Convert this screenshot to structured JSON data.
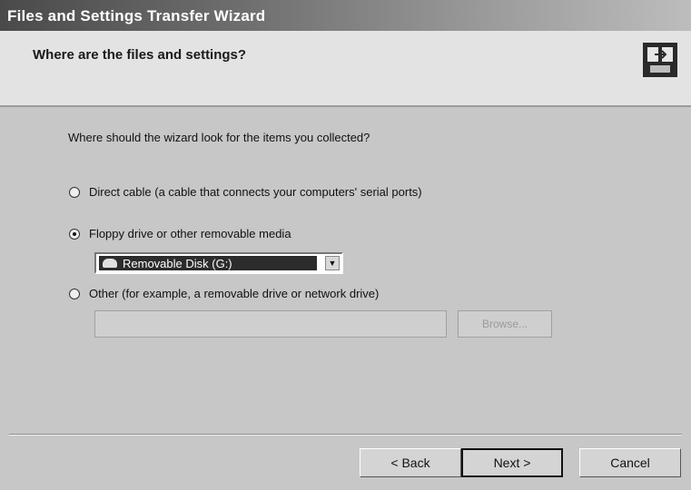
{
  "window": {
    "title": "Files and Settings Transfer Wizard"
  },
  "header": {
    "heading": "Where are the files and settings?",
    "icon": "wizard-transfer-icon"
  },
  "main": {
    "prompt": "Where should the wizard look for the items you collected?",
    "options": [
      {
        "label": "Direct cable (a cable that connects your computers' serial ports)",
        "selected": false
      },
      {
        "label": "Floppy drive or other removable media",
        "selected": true
      },
      {
        "label": "Other (for example, a removable drive or network drive)",
        "selected": false
      }
    ],
    "drive_select": {
      "value": "Removable Disk (G:)"
    },
    "path_input": {
      "value": ""
    },
    "browse_label": "Browse..."
  },
  "footer": {
    "back_label": "< Back",
    "next_label": "Next >",
    "cancel_label": "Cancel"
  },
  "colors": {
    "title_bar": "#4a4a4a",
    "header_background": "#e3e3e3",
    "body_background": "#c7c7c7",
    "selection": "#2c2c2c"
  }
}
